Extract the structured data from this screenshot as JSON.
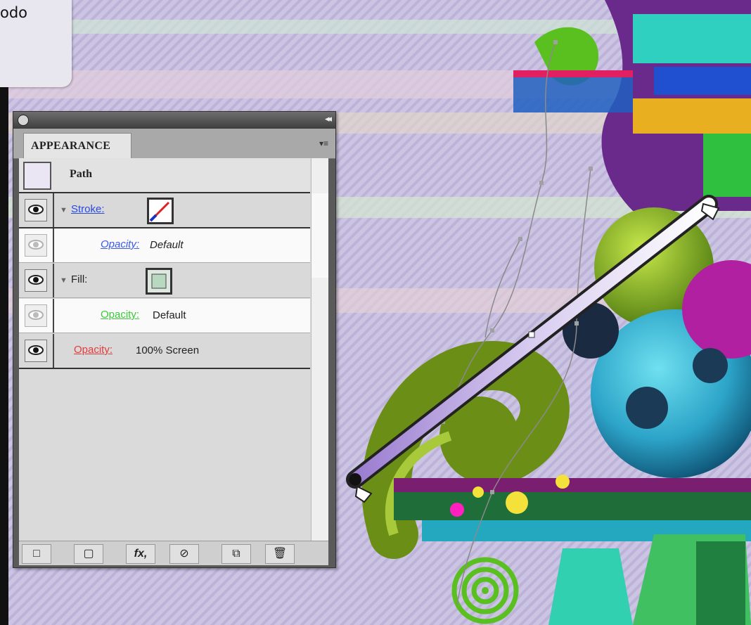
{
  "tooltip": {
    "text": "odo"
  },
  "panel": {
    "tab_label": "APPEARANCE",
    "collapse_glyph": "◂◂",
    "menu_glyph": "▾≡",
    "object_label": "Path",
    "rows": [
      {
        "kind": "stroke",
        "label": "Stroke:",
        "label_color": "#2a4be0"
      },
      {
        "kind": "opacity",
        "label": "Opacity:",
        "value": "Default",
        "label_color": "#3b5be8"
      },
      {
        "kind": "fill",
        "label": "Fill:"
      },
      {
        "kind": "opacity",
        "label": "Opacity:",
        "value": "Default",
        "label_color": "#3cc83c"
      },
      {
        "kind": "opacity",
        "label": "Opacity:",
        "value": "100% Screen",
        "label_color": "#e23b3b"
      }
    ],
    "toolbar": {
      "new_stroke": "□",
      "new_fill": "▢",
      "fx": "fx,",
      "clear": "⊘",
      "duplicate": "⧉",
      "delete": "🗑"
    }
  },
  "colors": {
    "stroke_accent": "#2a4be0",
    "fill_opacity_accent": "#3cc83c",
    "screen_opacity_accent": "#e23b3b",
    "canvas_bg": "#cdc6e2"
  }
}
